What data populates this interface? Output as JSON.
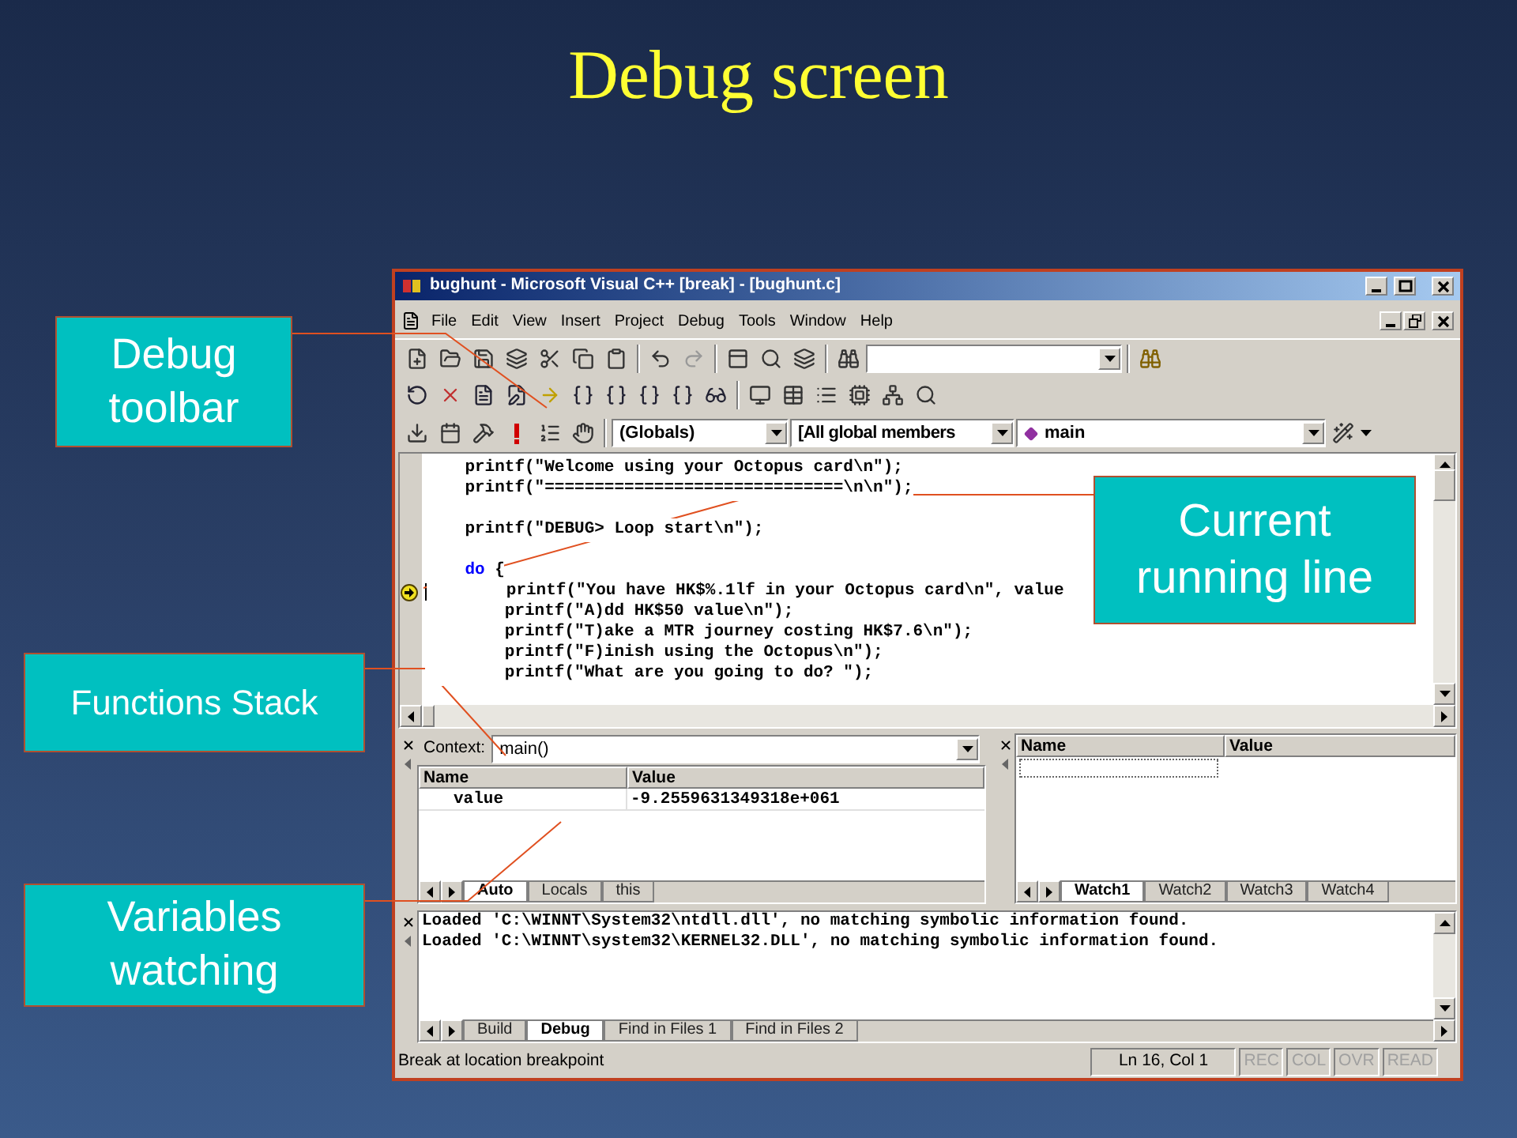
{
  "slide": {
    "title": "Debug screen"
  },
  "window": {
    "title": "bughunt - Microsoft Visual C++ [break] - [bughunt.c]"
  },
  "menu": [
    {
      "label": "File"
    },
    {
      "label": "Edit"
    },
    {
      "label": "View"
    },
    {
      "label": "Insert"
    },
    {
      "label": "Project"
    },
    {
      "label": "Debug"
    },
    {
      "label": "Tools"
    },
    {
      "label": "Window"
    },
    {
      "label": "Help"
    }
  ],
  "wizard_bar": {
    "scope": "(Globals)",
    "members": "[All global members",
    "function": "main"
  },
  "editor": {
    "lines": [
      {
        "segments": [
          {
            "kind": "plain",
            "text": "    printf(\"Welcome using your Octopus card\\n\");"
          }
        ],
        "current": false
      },
      {
        "segments": [
          {
            "kind": "plain",
            "text": "    printf(\"==============================\\n\\n\");"
          }
        ],
        "current": false
      },
      {
        "current": false
      },
      {
        "segments": [
          {
            "kind": "plain",
            "text": "    printf(\"DEBUG> Loop start\\n\");"
          }
        ],
        "current": false
      },
      {
        "current": false
      },
      {
        "segments": [
          {
            "kind": "keyword",
            "text": "    do"
          },
          {
            "kind": "plain",
            "text": " {"
          }
        ],
        "current": false
      },
      {
        "segments": [
          {
            "kind": "plain",
            "text": "        printf(\"You have HK$%.1lf in your Octopus card\\n\", value"
          }
        ],
        "current": true
      },
      {
        "segments": [
          {
            "kind": "plain",
            "text": "        printf(\"A)dd HK$50 value\\n\");"
          }
        ],
        "current": false
      },
      {
        "segments": [
          {
            "kind": "plain",
            "text": "        printf(\"T)ake a MTR journey costing HK$7.6\\n\");"
          }
        ],
        "current": false
      },
      {
        "segments": [
          {
            "kind": "plain",
            "text": "        printf(\"F)inish using the Octopus\\n\");"
          }
        ],
        "current": false
      },
      {
        "segments": [
          {
            "kind": "plain",
            "text": "        printf(\"What are you going to do? \");"
          }
        ],
        "current": false
      }
    ]
  },
  "variables": {
    "context_label": "Context:",
    "context_value": "main()",
    "columns": [
      "Name",
      "Value"
    ],
    "rows": [
      {
        "name": "value",
        "value": "-9.2559631349318e+061"
      }
    ],
    "tabs": [
      {
        "label": "Auto",
        "selected": true
      },
      {
        "label": "Locals",
        "selected": false
      },
      {
        "label": "this",
        "selected": false
      }
    ]
  },
  "watch": {
    "columns": [
      "Name",
      "Value"
    ],
    "tabs": [
      {
        "label": "Watch1",
        "selected": true
      },
      {
        "label": "Watch2",
        "selected": false
      },
      {
        "label": "Watch3",
        "selected": false
      },
      {
        "label": "Watch4",
        "selected": false
      }
    ]
  },
  "output": {
    "lines": [
      "Loaded 'C:\\WINNT\\System32\\ntdll.dll', no matching symbolic information found.",
      "Loaded 'C:\\WINNT\\system32\\KERNEL32.DLL', no matching symbolic information found."
    ],
    "tabs": [
      {
        "label": "Build",
        "selected": false
      },
      {
        "label": "Debug",
        "selected": true
      },
      {
        "label": "Find in Files 1",
        "selected": false
      },
      {
        "label": "Find in Files 2",
        "selected": false
      }
    ]
  },
  "status_bar": {
    "message": "Break at location breakpoint",
    "position": "Ln 16, Col 1",
    "indicators": [
      {
        "label": "REC",
        "enabled": false
      },
      {
        "label": "COL",
        "enabled": false
      },
      {
        "label": "OVR",
        "enabled": false
      },
      {
        "label": "READ",
        "enabled": false
      }
    ]
  },
  "callouts": [
    {
      "text": "Debug toolbar",
      "kind": "toolbar"
    },
    {
      "text": "Current running line",
      "kind": "line"
    },
    {
      "text": "Functions Stack",
      "kind": "stack"
    },
    {
      "text": "Variables watching",
      "kind": "vars"
    }
  ]
}
